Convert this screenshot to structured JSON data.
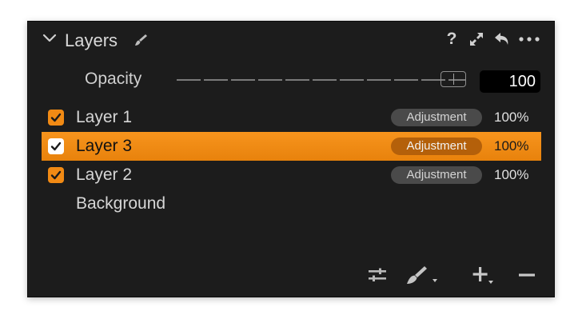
{
  "panel": {
    "title": "Layers",
    "icons": [
      "chevron-down-icon",
      "brush-icon",
      "help-icon",
      "expand-icon",
      "reset-icon",
      "more-icon"
    ]
  },
  "opacity": {
    "label": "Opacity",
    "value": "100",
    "slider_level": 1.0
  },
  "layers": [
    {
      "name": "Layer 1",
      "checked": true,
      "badge": "Adjustment",
      "opacity": "100%",
      "selected": false
    },
    {
      "name": "Layer 3",
      "checked": true,
      "badge": "Adjustment",
      "opacity": "100%",
      "selected": true
    },
    {
      "name": "Layer 2",
      "checked": true,
      "badge": "Adjustment",
      "opacity": "100%",
      "selected": false
    },
    {
      "name": "Background",
      "checked": null,
      "badge": "",
      "opacity": "",
      "selected": false
    }
  ],
  "help_glyph": "?",
  "footer": {
    "icons": [
      "adjustments-icon",
      "brush-dropdown-icon",
      "add-layer-icon",
      "remove-layer-icon"
    ]
  },
  "colors": {
    "accent": "#f18a14",
    "panel_bg": "#1c1c1c",
    "badge_bg": "#4a4a4a"
  }
}
